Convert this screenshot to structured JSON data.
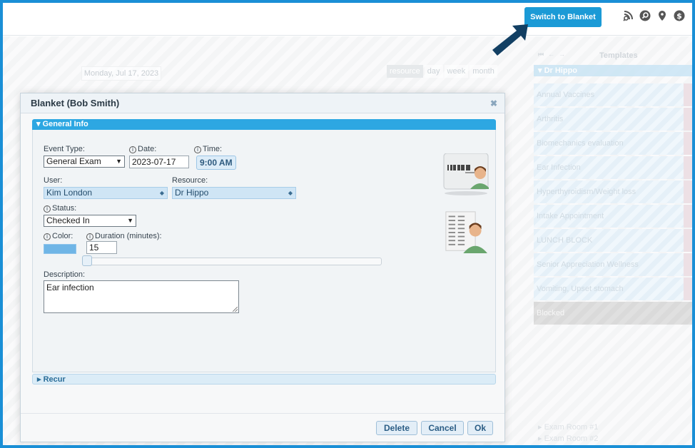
{
  "header": {
    "switch_label": "Switch to Blanket",
    "icons": [
      "rss-search-icon",
      "search-icon",
      "location-pin-icon",
      "dollar-icon"
    ]
  },
  "calendar": {
    "date_label": "Monday, Jul 17, 2023",
    "views": [
      "resource",
      "day",
      "week",
      "month"
    ]
  },
  "templates": {
    "title": "Templates",
    "group": "Dr Hippo",
    "items": [
      "Annual Vaccines",
      "Arthritis",
      "Biomechanics evaluation",
      "Ear Infection",
      "Hyperthyroidism/Weight loss",
      "Intake Appointment",
      "LUNCH BLOCK",
      "Senior Appreciation Wellness",
      "Vomiting, Upset stomach",
      "Blocked"
    ],
    "rooms": [
      "Exam Room #1",
      "Exam Room #2"
    ]
  },
  "dialog": {
    "title": "Blanket (Bob Smith)",
    "general_info": "General Info",
    "recur": "Recur",
    "event_type": {
      "label": "Event Type:",
      "value": "General Exam"
    },
    "date": {
      "label": "Date:",
      "value": "2023-07-17"
    },
    "time": {
      "label": "Time:",
      "value": "9:00 AM"
    },
    "user": {
      "label": "User:",
      "value": "Kim London"
    },
    "resource": {
      "label": "Resource:",
      "value": "Dr Hippo"
    },
    "status": {
      "label": "Status:",
      "value": "Checked In"
    },
    "color": {
      "label": "Color:",
      "value": "#6fb5e6"
    },
    "duration": {
      "label": "Duration (minutes):",
      "value": "15"
    },
    "description": {
      "label": "Description:",
      "value": "Ear infection"
    },
    "buttons": {
      "delete": "Delete",
      "cancel": "Cancel",
      "ok": "Ok"
    }
  }
}
